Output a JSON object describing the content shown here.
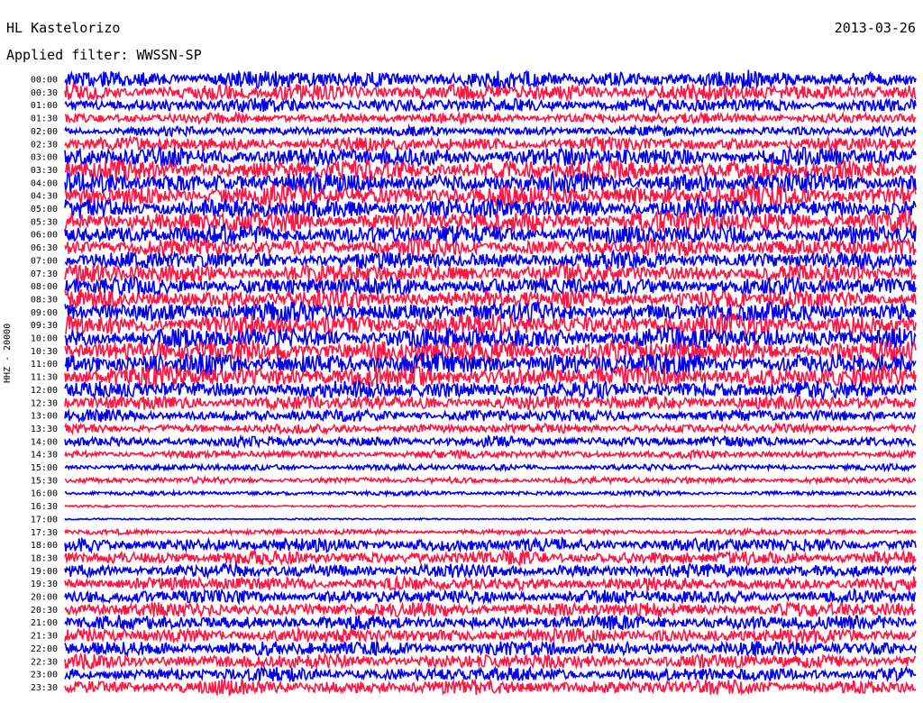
{
  "station_title": "HL Kastelorizo",
  "date": "2013-03-26",
  "filter_label": "Applied filter: WWSSN-SP",
  "channel_label": "HHZ - 20000",
  "colors": {
    "blue": "#0000ee",
    "red": "#ff1744"
  },
  "chart_data": {
    "type": "line",
    "title": "HL Kastelorizo",
    "ylabel": "HHZ - 20000",
    "x_range_minutes": [
      0,
      30
    ],
    "row_labels": [
      "00:00",
      "00:30",
      "01:00",
      "01:30",
      "02:00",
      "02:30",
      "03:00",
      "03:30",
      "04:00",
      "04:30",
      "05:00",
      "05:30",
      "06:00",
      "06:30",
      "07:00",
      "07:30",
      "08:00",
      "08:30",
      "09:00",
      "09:30",
      "10:00",
      "10:30",
      "11:00",
      "11:30",
      "12:00",
      "12:30",
      "13:00",
      "13:30",
      "14:00",
      "14:30",
      "15:00",
      "15:30",
      "16:00",
      "16:30",
      "17:00",
      "17:30",
      "18:00",
      "18:30",
      "19:00",
      "19:30",
      "20:00",
      "20:30",
      "21:00",
      "21:30",
      "22:00",
      "22:30",
      "23:00",
      "23:30"
    ],
    "series_colors": [
      "#0000ee",
      "#ff1744"
    ],
    "relative_noise_amplitude": [
      1.0,
      1.0,
      0.8,
      0.6,
      0.55,
      0.8,
      1.1,
      1.2,
      1.2,
      1.2,
      1.15,
      1.25,
      1.15,
      1.0,
      1.0,
      1.1,
      1.05,
      1.1,
      1.2,
      1.25,
      1.25,
      1.3,
      1.3,
      1.25,
      1.0,
      0.85,
      0.7,
      0.55,
      0.6,
      0.45,
      0.35,
      0.35,
      0.25,
      0.12,
      0.1,
      0.3,
      0.8,
      0.8,
      0.8,
      0.8,
      0.8,
      0.85,
      0.85,
      0.85,
      0.85,
      0.85,
      0.8,
      0.85
    ]
  }
}
